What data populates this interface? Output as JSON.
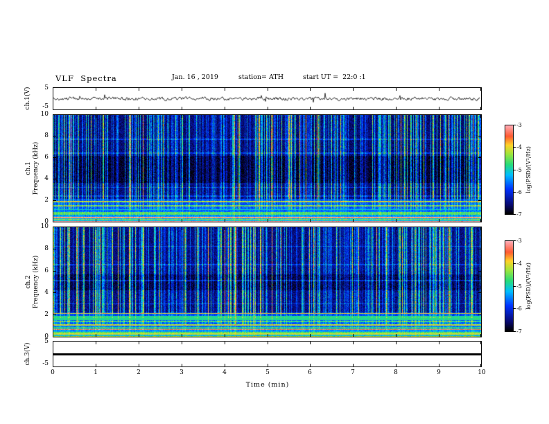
{
  "header": {
    "title": "VLF  Spectra",
    "date": "Jan. 16 , 2019",
    "station": "station= ATH",
    "start_ut": "start UT =  22:0 :1"
  },
  "x_axis": {
    "label": "Time  (min)",
    "range": [
      0,
      10
    ],
    "ticks": [
      0,
      1,
      2,
      3,
      4,
      5,
      6,
      7,
      8,
      9,
      10
    ]
  },
  "panels": {
    "ch1_waveform": {
      "ylabel": "ch.1(V)",
      "ylim": [
        -5,
        5
      ],
      "yticks": [
        5,
        -5
      ]
    },
    "ch1_spectrogram": {
      "ylabel_line1": "ch.1",
      "ylabel_line2": "Frequency (kHz)",
      "ylim": [
        0,
        10
      ],
      "yticks": [
        10,
        8,
        6,
        4,
        2,
        0
      ]
    },
    "ch2_spectrogram": {
      "ylabel_line1": "ch.2",
      "ylabel_line2": "Frequency (kHz)",
      "ylim": [
        0,
        10
      ],
      "yticks": [
        10,
        8,
        6,
        4,
        2,
        0
      ]
    },
    "ch3_waveform": {
      "ylabel": "ch.3(V)",
      "ylim": [
        -5,
        5
      ],
      "yticks": [
        5,
        -5
      ]
    }
  },
  "colorbar": {
    "label": "log(PSD)/(V²/Hz)",
    "range": [
      -7,
      -3
    ],
    "ticks": [
      -3,
      -4,
      -5,
      -6,
      -7
    ],
    "colormap_stops": [
      {
        "t": 0.0,
        "color": "#000000"
      },
      {
        "t": 0.1,
        "color": "#08086e"
      },
      {
        "t": 0.28,
        "color": "#0032ff"
      },
      {
        "t": 0.44,
        "color": "#00beff"
      },
      {
        "t": 0.56,
        "color": "#28dc78"
      },
      {
        "t": 0.68,
        "color": "#a0e63c"
      },
      {
        "t": 0.78,
        "color": "#ffd228"
      },
      {
        "t": 0.88,
        "color": "#ff5a32"
      },
      {
        "t": 1.0,
        "color": "#ffaab4"
      }
    ]
  },
  "chart_data": [
    {
      "type": "line",
      "name": "ch.1 voltage waveform",
      "xlabel": "Time (min)",
      "x_range": [
        0,
        10
      ],
      "ylim": [
        -5,
        5
      ],
      "summary": "continuous band-limited noise of roughly ±1 V about 0 V for the full 10 minutes, with sparse impulsive spikes reaching about ±2.5 V"
    },
    {
      "type": "heatmap",
      "name": "ch.1 VLF spectrogram",
      "x_range": [
        0,
        10
      ],
      "y_range_khz": [
        0,
        10
      ],
      "z_range_log_psd": [
        -7,
        -3
      ],
      "features": [
        "dense vertical sferic streaks (-5.5 to -4) spanning 2-10 kHz throughout the record",
        "quiet dark band (about -6.9) near 4-6 kHz",
        "strong horizontal harmonic banding below 2 kHz (-5 to -3.5)",
        "narrow intense red band near 0.4 kHz (about -3.7)",
        "faint horizontal lines near 2.5, 3.3, 6.5 and 7.8 kHz"
      ]
    },
    {
      "type": "heatmap",
      "name": "ch.2 VLF spectrogram",
      "x_range": [
        0,
        10
      ],
      "y_range_khz": [
        0,
        10
      ],
      "z_range_log_psd": [
        -7,
        -3
      ],
      "features": [
        "dense vertical sferic streaks (-5.5 to -4) spanning 2-10 kHz throughout the record",
        "slightly quieter band near 4.3-5.7 kHz",
        "bright green band near 1.5-1.9 kHz (about -4.8)",
        "strong horizontal harmonic banding below 2 kHz (-5 to -4)",
        "faint horizontal lines near 2.2, 3.0, 5.2, 6.6 and 8.3 kHz"
      ]
    },
    {
      "type": "line",
      "name": "ch.3 voltage waveform",
      "x_range": [
        0,
        10
      ],
      "ylim": [
        -5,
        5
      ],
      "summary": "constant flat line at 0 V (no signal) for the full 10 minutes"
    }
  ]
}
